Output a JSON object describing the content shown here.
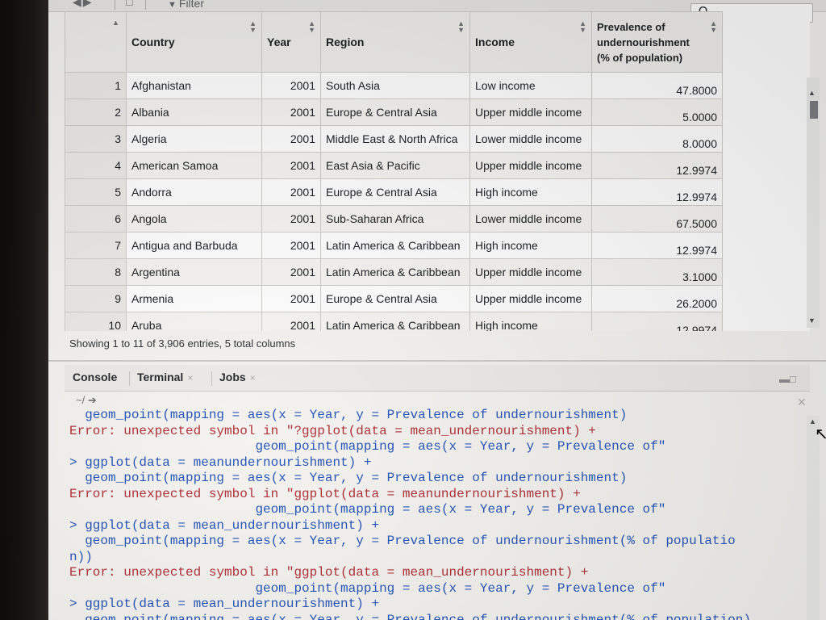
{
  "toolbar": {
    "filter_label": "Filter",
    "search_icon": "search-icon"
  },
  "table": {
    "columns": [
      {
        "label": ""
      },
      {
        "label": "Country"
      },
      {
        "label": "Year"
      },
      {
        "label": "Region"
      },
      {
        "label": "Income"
      },
      {
        "label": "Prevalence of undernourishment (% of population)"
      }
    ],
    "header_lines": [
      "Prevalence of",
      "undernourishment",
      "(% of population)"
    ],
    "rows": [
      {
        "n": "1",
        "country": "Afghanistan",
        "year": "2001",
        "region": "South Asia",
        "income": "Low income",
        "value": "47.8000"
      },
      {
        "n": "2",
        "country": "Albania",
        "year": "2001",
        "region": "Europe & Central Asia",
        "income": "Upper middle income",
        "value": "5.0000"
      },
      {
        "n": "3",
        "country": "Algeria",
        "year": "2001",
        "region": "Middle East & North Africa",
        "income": "Lower middle income",
        "value": "8.0000"
      },
      {
        "n": "4",
        "country": "American Samoa",
        "year": "2001",
        "region": "East Asia & Pacific",
        "income": "Upper middle income",
        "value": "12.9974"
      },
      {
        "n": "5",
        "country": "Andorra",
        "year": "2001",
        "region": "Europe & Central Asia",
        "income": "High income",
        "value": "12.9974"
      },
      {
        "n": "6",
        "country": "Angola",
        "year": "2001",
        "region": "Sub-Saharan Africa",
        "income": "Lower middle income",
        "value": "67.5000"
      },
      {
        "n": "7",
        "country": "Antigua and Barbuda",
        "year": "2001",
        "region": "Latin America & Caribbean",
        "income": "High income",
        "value": "12.9974"
      },
      {
        "n": "8",
        "country": "Argentina",
        "year": "2001",
        "region": "Latin America & Caribbean",
        "income": "Upper middle income",
        "value": "3.1000"
      },
      {
        "n": "9",
        "country": "Armenia",
        "year": "2001",
        "region": "Europe & Central Asia",
        "income": "Upper middle income",
        "value": "26.2000"
      },
      {
        "n": "10",
        "country": "Aruba",
        "year": "2001",
        "region": "Latin America & Caribbean",
        "income": "High income",
        "value": "12.9974"
      }
    ],
    "status": "Showing 1 to 11 of 3,906 entries, 5 total columns"
  },
  "console_pane": {
    "tabs": [
      "Console",
      "Terminal",
      "Jobs"
    ],
    "path": "~/",
    "lines": [
      {
        "type": "code",
        "text": "  geom_point(mapping = aes(x = Year, y = Prevalence of undernourishment)"
      },
      {
        "type": "err",
        "text": "Error: unexpected symbol in \"?ggplot(data = mean_undernourishment) +"
      },
      {
        "type": "code",
        "text": "                        geom_point(mapping = aes(x = Year, y = Prevalence of\""
      },
      {
        "type": "code",
        "text": "> ggplot(data = meanundernourishment) +"
      },
      {
        "type": "code",
        "text": "  geom_point(mapping = aes(x = Year, y = Prevalence of undernourishment)"
      },
      {
        "type": "err",
        "text": "Error: unexpected symbol in \"ggplot(data = meanundernourishment) +"
      },
      {
        "type": "code",
        "text": "                        geom_point(mapping = aes(x = Year, y = Prevalence of\""
      },
      {
        "type": "code",
        "text": "> ggplot(data = mean_undernourishment) +"
      },
      {
        "type": "code",
        "text": "  geom_point(mapping = aes(x = Year, y = Prevalence of undernourishment(% of populatio"
      },
      {
        "type": "code",
        "text": "n))"
      },
      {
        "type": "err",
        "text": "Error: unexpected symbol in \"ggplot(data = mean_undernourishment) +"
      },
      {
        "type": "code",
        "text": "                        geom_point(mapping = aes(x = Year, y = Prevalence of\""
      },
      {
        "type": "code",
        "text": "> ggplot(data = mean_undernourishment) +"
      },
      {
        "type": "code",
        "text": "  geom_point(mapping = aes(x = Year, y = Prevalence of undernourishment(% of population)"
      }
    ]
  },
  "colors": {
    "code": "#2a57b8",
    "error": "#b0343a",
    "header_bg": "#f0efec"
  }
}
